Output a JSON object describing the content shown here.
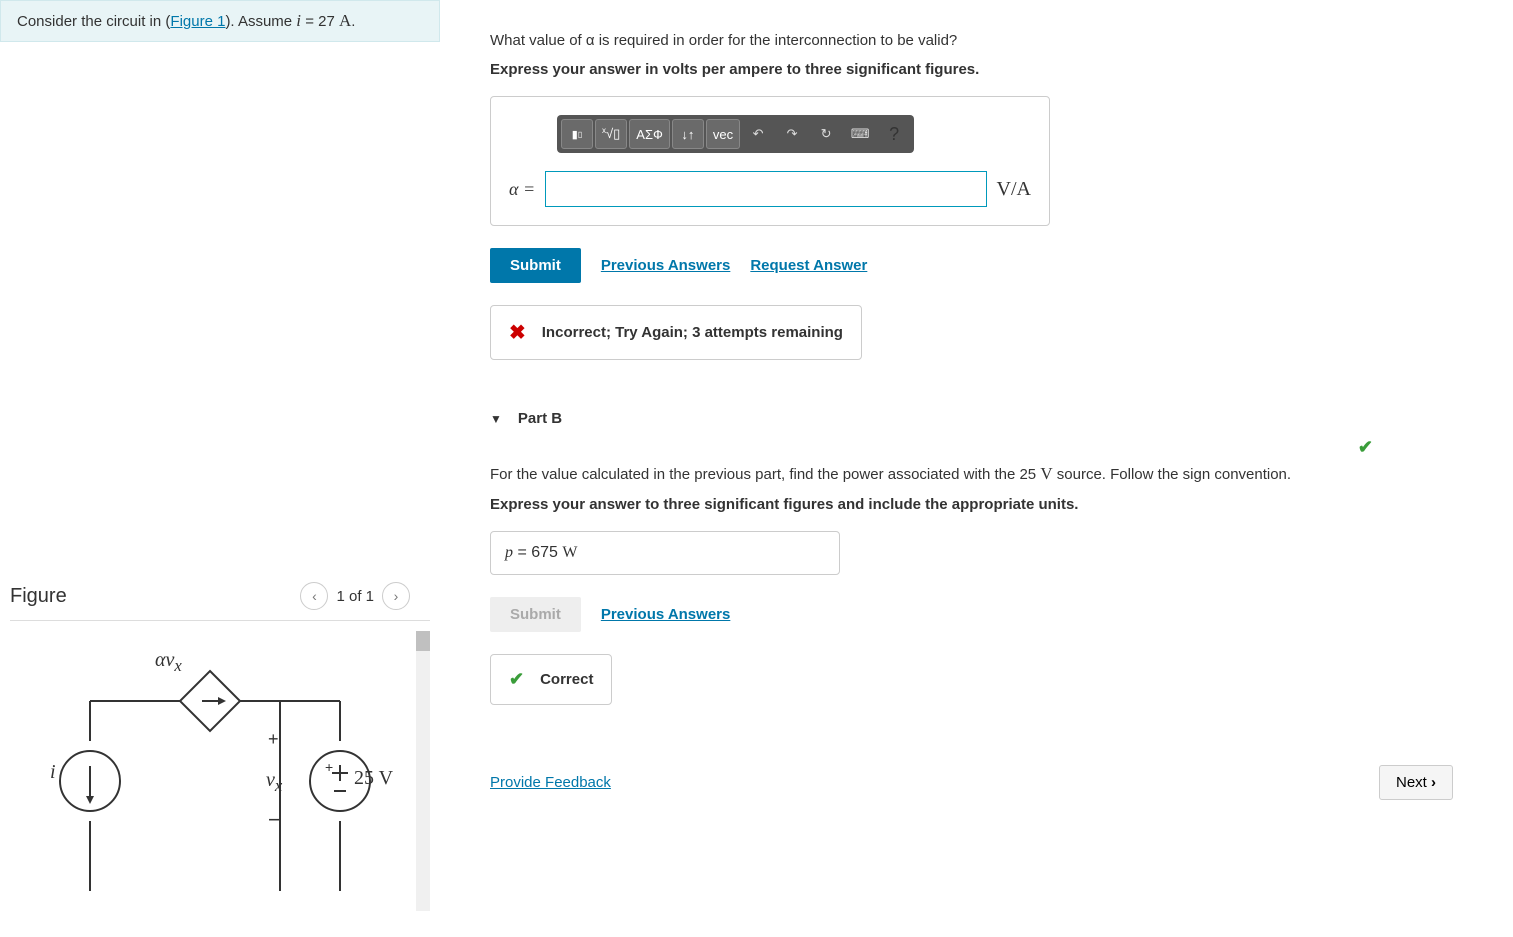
{
  "problem": {
    "prefix": "Consider the circuit in (",
    "figure_link": "Figure 1",
    "mid": "). Assume ",
    "var": "i",
    "eq": " = 27 ",
    "unit": "A",
    "suffix": "."
  },
  "figure": {
    "title": "Figure",
    "count": "1 of 1",
    "labels": {
      "alpha_vx": "αv",
      "alpha_vx_sub": "x",
      "plus": "+",
      "minus": "−",
      "i": "i",
      "vx": "v",
      "vx_sub": "x",
      "v25": "25 V"
    }
  },
  "partA": {
    "question": "What value of α is required in order for the interconnection to be valid?",
    "instruction": "Express your answer in volts per ampere to three significant figures.",
    "alpha_label": "α =",
    "unit": "V/A",
    "toolbar": {
      "templates": "▮",
      "sqrt": "√▯",
      "greek": "ΑΣФ",
      "scripts": "↓↑",
      "vec": "vec",
      "undo": "↶",
      "redo": "↷",
      "reset": "↻",
      "keyboard": "⌨",
      "help": "?"
    },
    "submit": "Submit",
    "prev_answers": "Previous Answers",
    "request_answer": "Request Answer",
    "feedback": "Incorrect; Try Again; 3 attempts remaining"
  },
  "partB": {
    "title": "Part B",
    "question_pre": "For the value calculated in the previous part, find the power associated with the 25 ",
    "question_unit": "V",
    "question_post": " source. Follow the sign convention.",
    "instruction": "Express your answer to three significant figures and include the appropriate units.",
    "answer_var": "p",
    "answer_eq": " =  675 ",
    "answer_unit": "W",
    "submit": "Submit",
    "prev_answers": "Previous Answers",
    "feedback": "Correct"
  },
  "footer": {
    "feedback_link": "Provide Feedback",
    "next": "Next"
  }
}
